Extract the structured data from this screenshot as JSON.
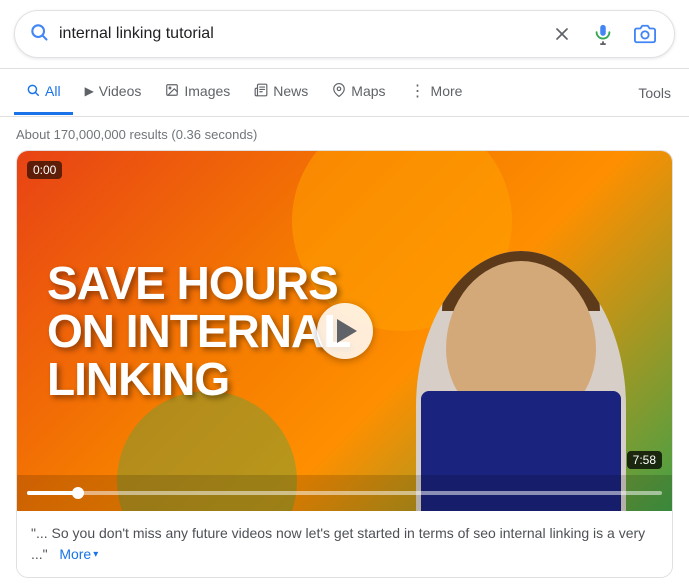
{
  "search": {
    "query": "internal linking tutorial",
    "placeholder": "internal linking tutorial"
  },
  "tabs": [
    {
      "id": "all",
      "label": "All",
      "icon": "🔍",
      "active": true
    },
    {
      "id": "videos",
      "label": "Videos",
      "icon": "▶",
      "active": false
    },
    {
      "id": "images",
      "label": "Images",
      "icon": "🖼",
      "active": false
    },
    {
      "id": "news",
      "label": "News",
      "icon": "📰",
      "active": false
    },
    {
      "id": "maps",
      "label": "Maps",
      "icon": "📍",
      "active": false
    },
    {
      "id": "more",
      "label": "More",
      "icon": "⋮",
      "active": false
    }
  ],
  "tools_label": "Tools",
  "results_count": "About 170,000,000 results (0.36 seconds)",
  "video": {
    "title_line1": "SAVE HOURS",
    "title_line2": "ON INTERNAL",
    "title_line3": "LINKING",
    "timestamp": "0:00",
    "duration": "7:58",
    "description_prefix": "\"... So you don't miss any future videos now let's get started in terms of seo internal linking is a very ...\"",
    "more_label": "More"
  }
}
